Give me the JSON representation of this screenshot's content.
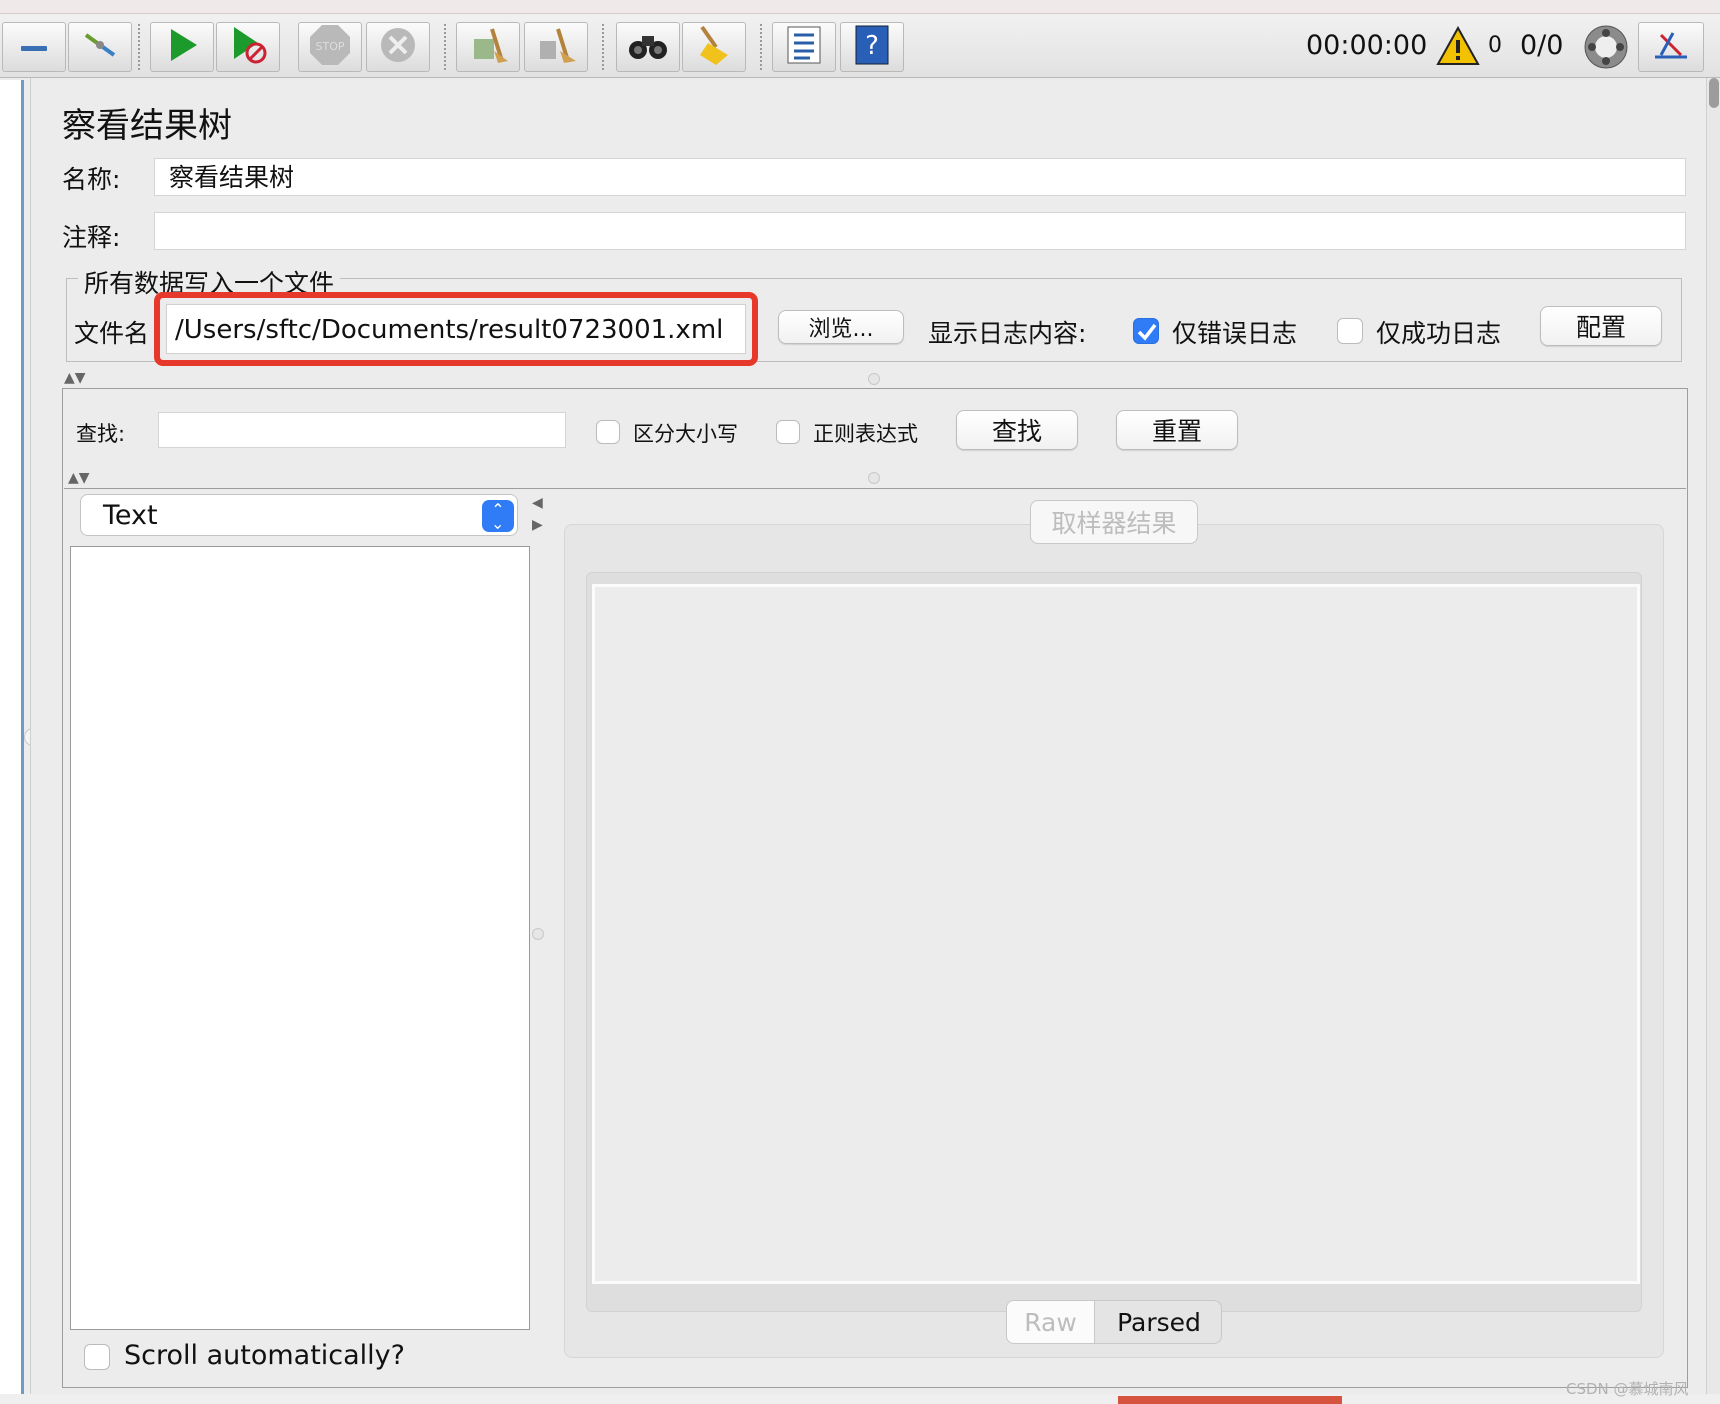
{
  "toolbar": {
    "timer": "00:00:00",
    "warning_count": "0",
    "thread_ratio": "0/0"
  },
  "icons": [
    "minus-icon",
    "toggle-icon",
    "start-icon",
    "start-no-pause-icon",
    "stop-icon",
    "shutdown-icon",
    "clear-icon",
    "clear-all-icon",
    "search-icon",
    "reset-search-icon",
    "function-helper-icon",
    "help-icon",
    "warning-icon",
    "remote-icon",
    "log-viewer-icon"
  ],
  "header": {
    "title": "察看结果树"
  },
  "form": {
    "name_label": "名称:",
    "name_value": "察看结果树",
    "comment_label": "注释:",
    "comment_value": ""
  },
  "file_section": {
    "legend": "所有数据写入一个文件",
    "filename_label": "文件名",
    "filename_value": "/Users/sftc/Documents/result0723001.xml",
    "browse_label": "浏览...",
    "log_display_label": "显示日志内容:",
    "errors_only_label": "仅错误日志",
    "errors_only_checked": true,
    "success_only_label": "仅成功日志",
    "success_only_checked": false,
    "configure_label": "配置"
  },
  "search": {
    "label": "查找:",
    "value": "",
    "case_sensitive_label": "区分大小写",
    "regex_label": "正则表达式",
    "find_button": "查找",
    "reset_button": "重置"
  },
  "results": {
    "renderer_selected": "Text",
    "tab_label": "取样器结果",
    "raw_label": "Raw",
    "parsed_label": "Parsed",
    "scroll_auto_label": "Scroll automatically?",
    "scroll_auto_checked": false
  },
  "colors": {
    "highlight": "#e6392b",
    "accent": "#2f7cf6"
  },
  "watermark": "CSDN @慕城南风"
}
